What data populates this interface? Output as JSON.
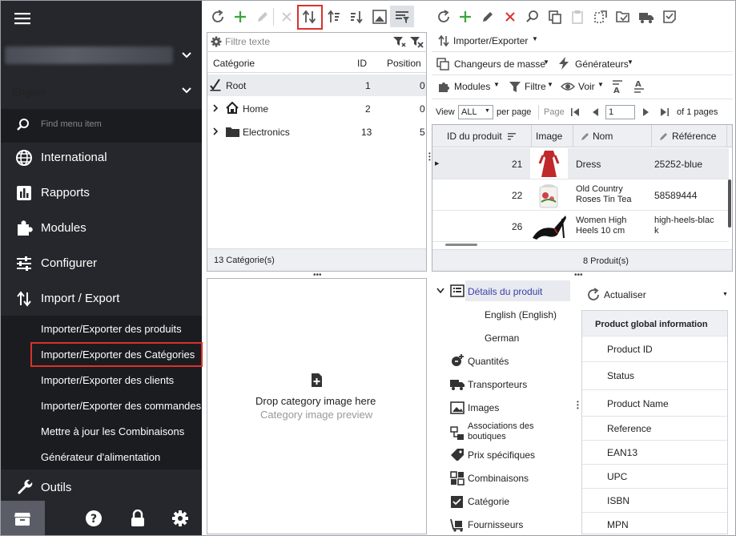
{
  "sidebar": {
    "language": "English",
    "find_placeholder": "Find menu item",
    "nav": [
      {
        "label": "International"
      },
      {
        "label": "Rapports"
      },
      {
        "label": "Modules"
      },
      {
        "label": "Configurer"
      },
      {
        "label": "Import / Export"
      }
    ],
    "sub": [
      {
        "label": "Importer/Exporter des produits"
      },
      {
        "label": "Importer/Exporter des Catégories"
      },
      {
        "label": "Importer/Exporter des clients"
      },
      {
        "label": "Importer/Exporter des commandes"
      },
      {
        "label": "Mettre à jour les Combinaisons"
      },
      {
        "label": "Générateur d'alimentation"
      }
    ],
    "tools": "Outils"
  },
  "left": {
    "filter_placeholder": "Filtre texte",
    "columns": {
      "category": "Catégorie",
      "id": "ID",
      "position": "Position"
    },
    "rows": [
      {
        "name": "Root",
        "id": "1",
        "pos": "0"
      },
      {
        "name": "Home",
        "id": "2",
        "pos": "0"
      },
      {
        "name": "Electronics",
        "id": "13",
        "pos": "5"
      }
    ],
    "footer": "13 Catégorie(s)"
  },
  "right": {
    "menu": {
      "import_export": "Importer/Exporter",
      "mass_changers": "Changeurs de masse",
      "generators": "Générateurs",
      "modules": "Modules",
      "filter": "Filtre",
      "view": "Voir"
    },
    "pager": {
      "view": "View",
      "all": "ALL",
      "per_page": "per page",
      "page": "Page",
      "page_value": "1",
      "of_pages": "of 1 pages"
    },
    "columns": {
      "id": "ID du produit",
      "image": "Image",
      "name": "Nom",
      "ref": "Référence"
    },
    "rows": [
      {
        "id": "21",
        "name": "Dress",
        "ref": "25252-blue"
      },
      {
        "id": "22",
        "name": "Old Country Roses Tin Tea",
        "ref": "58589444"
      },
      {
        "id": "26",
        "name": "Women High Heels 10 cm",
        "ref": "high-heels-black"
      }
    ],
    "footer": "8 Produit(s)"
  },
  "drop": {
    "title": "Drop category image here",
    "subtitle": "Category image preview"
  },
  "tree": {
    "details": "Détails du produit",
    "lang_en": "English (English)",
    "lang_de": "German",
    "items": [
      {
        "label": "Quantités"
      },
      {
        "label": "Transporteurs"
      },
      {
        "label": "Images"
      },
      {
        "label": "Associations des boutiques"
      },
      {
        "label": "Prix spécifiques"
      },
      {
        "label": "Combinaisons"
      },
      {
        "label": "Catégorie"
      },
      {
        "label": "Fournisseurs"
      }
    ]
  },
  "props": {
    "refresh": "Actualiser",
    "header": "Product global information",
    "rows": [
      {
        "label": "Product ID"
      },
      {
        "label": "Status"
      },
      {
        "label": "Product Name"
      },
      {
        "label": "Reference"
      },
      {
        "label": "EAN13"
      },
      {
        "label": "UPC"
      },
      {
        "label": "ISBN"
      },
      {
        "label": "MPN"
      }
    ]
  },
  "colors": {
    "sidebar": "#25272c",
    "submenu": "#1b1c20",
    "highlight": "#d9312b",
    "add": "#3aa63a",
    "delete": "#d9312b",
    "selected": "#3b3fa8"
  }
}
